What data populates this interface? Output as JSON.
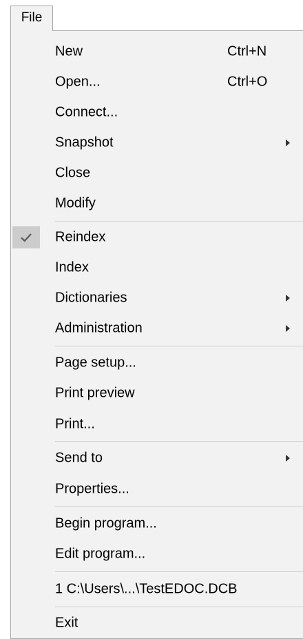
{
  "menubar": {
    "title": "File"
  },
  "menu": {
    "new": {
      "label": "New",
      "shortcut": "Ctrl+N"
    },
    "open": {
      "label": "Open...",
      "shortcut": "Ctrl+O"
    },
    "connect": {
      "label": "Connect..."
    },
    "snapshot": {
      "label": "Snapshot",
      "has_submenu": true
    },
    "close": {
      "label": "Close"
    },
    "modify": {
      "label": "Modify"
    },
    "reindex": {
      "label": "Reindex",
      "checked": true
    },
    "index": {
      "label": "Index"
    },
    "dictionaries": {
      "label": "Dictionaries",
      "has_submenu": true
    },
    "administration": {
      "label": "Administration",
      "has_submenu": true
    },
    "page_setup": {
      "label": "Page setup..."
    },
    "print_preview": {
      "label": "Print preview"
    },
    "print": {
      "label": "Print..."
    },
    "send_to": {
      "label": "Send to",
      "has_submenu": true
    },
    "properties": {
      "label": "Properties..."
    },
    "begin_program": {
      "label": "Begin program..."
    },
    "edit_program": {
      "label": "Edit program..."
    },
    "recent_1": {
      "label": "1 C:\\Users\\...\\TestEDOC.DCB"
    },
    "exit": {
      "label": "Exit"
    }
  },
  "colors": {
    "menu_bg": "#f2f2f2",
    "border": "#a8a8a8",
    "separator": "#cfcfcf",
    "check_bg": "#cccccc"
  },
  "icons": {
    "check": "checkmark-icon",
    "submenu": "submenu-arrow-icon"
  }
}
